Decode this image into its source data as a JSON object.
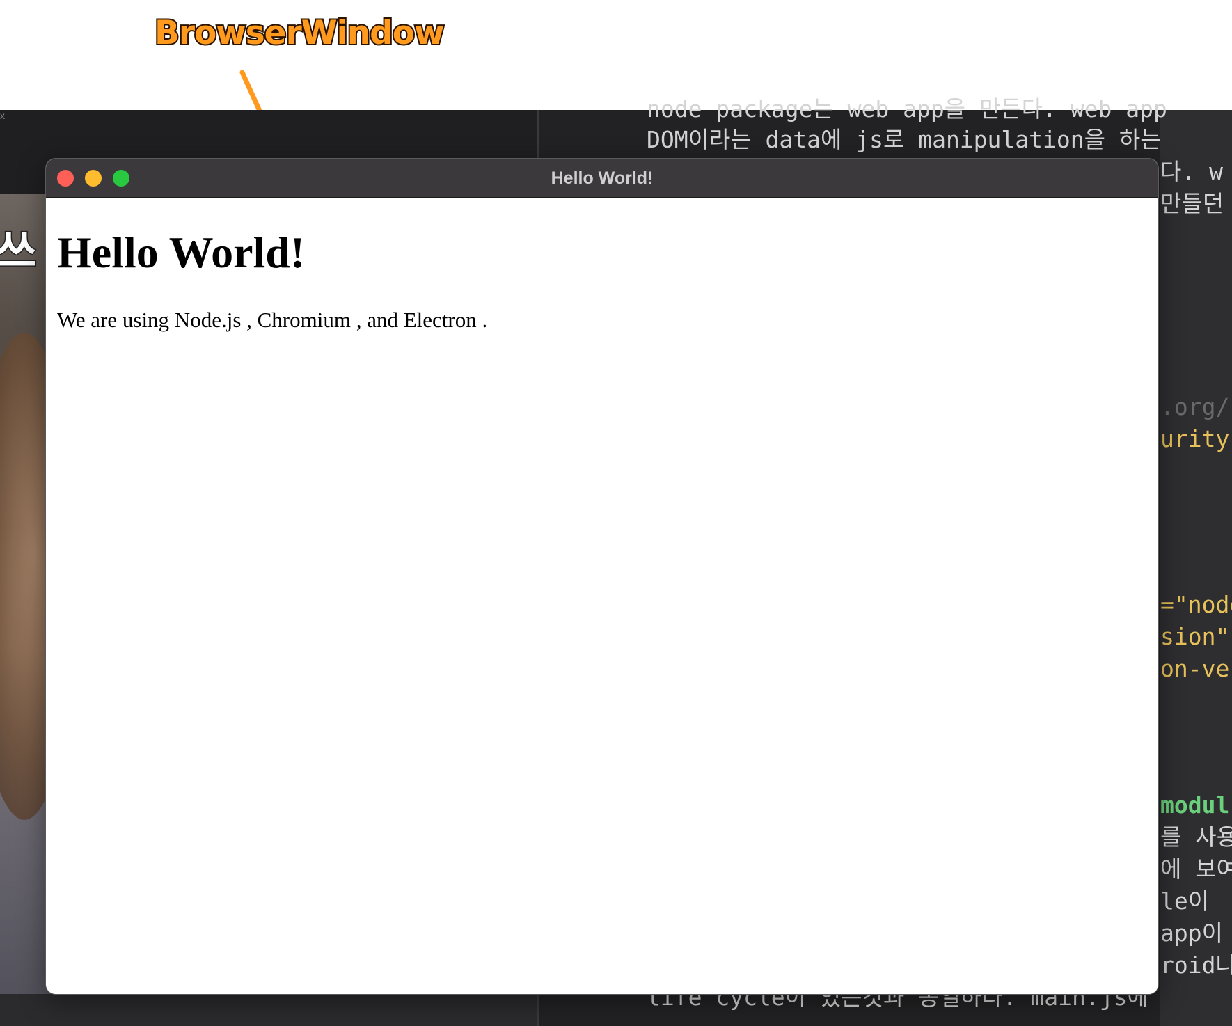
{
  "annotation": {
    "label": "BrowserWindow",
    "accent_color": "#ff9a1f"
  },
  "background": {
    "video_caption": "쓰",
    "close_marker": "x",
    "editor_lines": [
      {
        "text": "node package는 web app을 만든다. web app",
        "style": "normal"
      },
      {
        "text": "DOM이라는 data에 js로 manipulation을 하는",
        "style": "normal"
      },
      {
        "text": "다. w",
        "style": "normal"
      },
      {
        "text": "만들던",
        "style": "normal"
      },
      {
        "text": ".org/",
        "style": "muted"
      },
      {
        "text": "urity-",
        "style": "yellow"
      },
      {
        "text": "=\"node",
        "style": "yellow"
      },
      {
        "text": "sion\":",
        "style": "yellow"
      },
      {
        "text": "on-ve",
        "style": "yellow"
      },
      {
        "text": "modul",
        "style": "green"
      },
      {
        "text": "를 사용",
        "style": "normal"
      },
      {
        "text": "에 보여",
        "style": "normal"
      },
      {
        "text": "le이",
        "style": "normal"
      },
      {
        "text": "app이",
        "style": "normal"
      },
      {
        "text": "roid나",
        "style": "normal"
      },
      {
        "text": "life cycle이 있는것과 동일하다.  main.js에",
        "style": "normal"
      }
    ]
  },
  "window": {
    "title": "Hello World!",
    "buttons": {
      "close_color": "#fe5f57",
      "minimize_color": "#febc2e",
      "maximize_color": "#28c840"
    },
    "content": {
      "heading": "Hello World!",
      "paragraph": "We are using Node.js , Chromium , and Electron ."
    }
  }
}
